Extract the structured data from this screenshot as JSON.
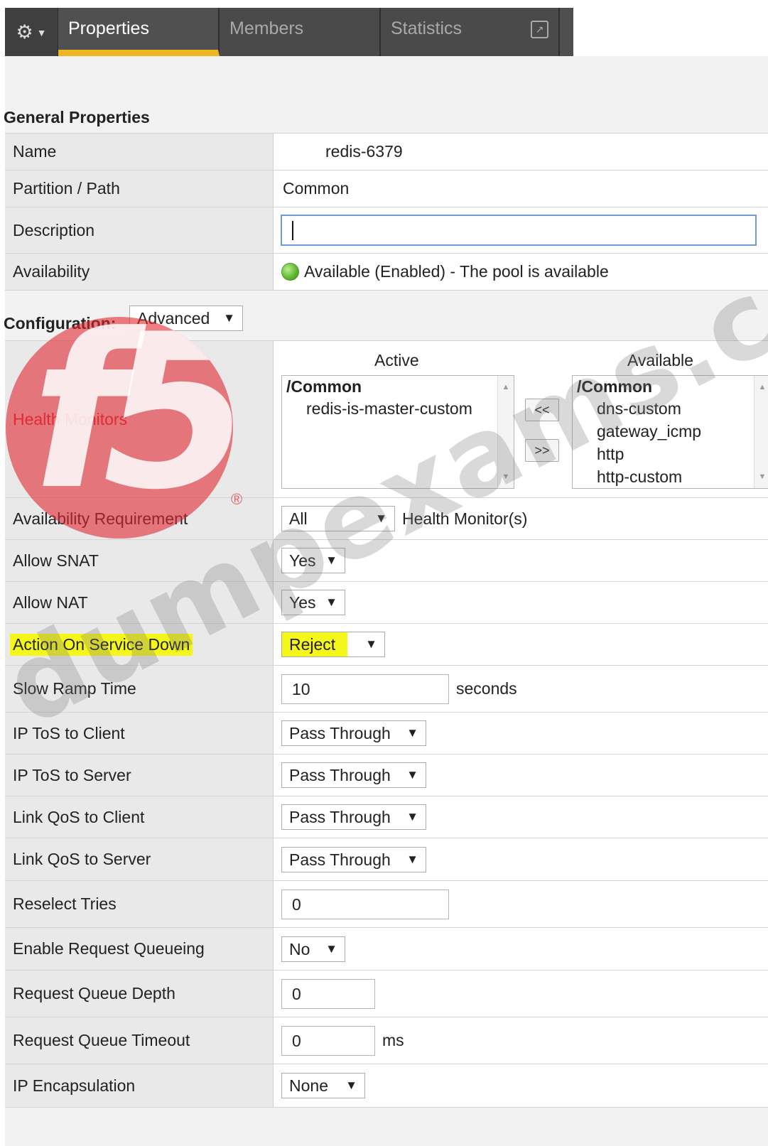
{
  "tabs": {
    "gear_icon": "gear-icon",
    "properties": "Properties",
    "members": "Members",
    "statistics": "Statistics"
  },
  "general": {
    "title": "General Properties",
    "name_label": "Name",
    "name_value": "redis-6379",
    "partition_label": "Partition / Path",
    "partition_value": "Common",
    "description_label": "Description",
    "description_value": "",
    "availability_label": "Availability",
    "availability_value": "Available (Enabled) - The pool is available",
    "status_color": "#5cb531"
  },
  "configuration": {
    "label": "Configuration:",
    "mode": "Advanced"
  },
  "health": {
    "label": "Health Monitors",
    "active_header": "Active",
    "available_header": "Available",
    "active_group": "/Common",
    "active_items": [
      "redis-is-master-custom"
    ],
    "available_group": "/Common",
    "available_items": [
      "dns-custom",
      "gateway_icmp",
      "http",
      "http-custom"
    ],
    "add_button": "<<",
    "remove_button": ">>"
  },
  "settings": {
    "availability_req_label": "Availability Requirement",
    "availability_req_value": "All",
    "availability_req_suffix": "Health Monitor(s)",
    "snat_label": "Allow SNAT",
    "snat_value": "Yes",
    "nat_label": "Allow NAT",
    "nat_value": "Yes",
    "action_down_label": "Action On Service Down",
    "action_down_value": "Reject",
    "slow_ramp_label": "Slow Ramp Time",
    "slow_ramp_value": "10",
    "slow_ramp_unit": "seconds",
    "tos_client_label": "IP ToS to Client",
    "tos_client_value": "Pass Through",
    "tos_server_label": "IP ToS to Server",
    "tos_server_value": "Pass Through",
    "qos_client_label": "Link QoS to Client",
    "qos_client_value": "Pass Through",
    "qos_server_label": "Link QoS to Server",
    "qos_server_value": "Pass Through",
    "reselect_label": "Reselect Tries",
    "reselect_value": "0",
    "queueing_label": "Enable Request Queueing",
    "queueing_value": "No",
    "queue_depth_label": "Request Queue Depth",
    "queue_depth_value": "0",
    "queue_timeout_label": "Request Queue Timeout",
    "queue_timeout_value": "0",
    "queue_timeout_unit": "ms",
    "encap_label": "IP Encapsulation",
    "encap_value": "None"
  },
  "watermark": {
    "logo": "f5",
    "registered": "®",
    "text": "dumpexams.com"
  },
  "colors": {
    "tab_accent": "#f0b622",
    "highlight": "#f5f61a",
    "watermark_red": "#df2832"
  }
}
